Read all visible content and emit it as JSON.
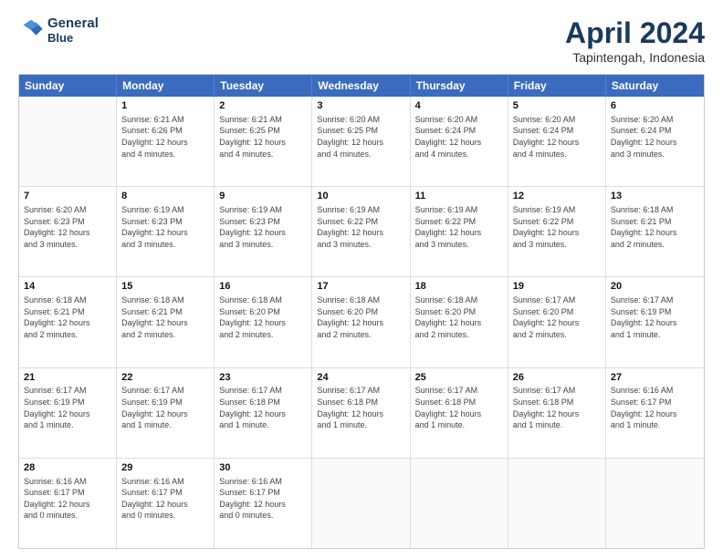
{
  "logo": {
    "line1": "General",
    "line2": "Blue"
  },
  "title": {
    "month_year": "April 2024",
    "location": "Tapintengah, Indonesia"
  },
  "header": {
    "days": [
      "Sunday",
      "Monday",
      "Tuesday",
      "Wednesday",
      "Thursday",
      "Friday",
      "Saturday"
    ]
  },
  "rows": [
    [
      {
        "day": "",
        "info": ""
      },
      {
        "day": "1",
        "info": "Sunrise: 6:21 AM\nSunset: 6:26 PM\nDaylight: 12 hours\nand 4 minutes."
      },
      {
        "day": "2",
        "info": "Sunrise: 6:21 AM\nSunset: 6:25 PM\nDaylight: 12 hours\nand 4 minutes."
      },
      {
        "day": "3",
        "info": "Sunrise: 6:20 AM\nSunset: 6:25 PM\nDaylight: 12 hours\nand 4 minutes."
      },
      {
        "day": "4",
        "info": "Sunrise: 6:20 AM\nSunset: 6:24 PM\nDaylight: 12 hours\nand 4 minutes."
      },
      {
        "day": "5",
        "info": "Sunrise: 6:20 AM\nSunset: 6:24 PM\nDaylight: 12 hours\nand 4 minutes."
      },
      {
        "day": "6",
        "info": "Sunrise: 6:20 AM\nSunset: 6:24 PM\nDaylight: 12 hours\nand 3 minutes."
      }
    ],
    [
      {
        "day": "7",
        "info": "Sunrise: 6:20 AM\nSunset: 6:23 PM\nDaylight: 12 hours\nand 3 minutes."
      },
      {
        "day": "8",
        "info": "Sunrise: 6:19 AM\nSunset: 6:23 PM\nDaylight: 12 hours\nand 3 minutes."
      },
      {
        "day": "9",
        "info": "Sunrise: 6:19 AM\nSunset: 6:23 PM\nDaylight: 12 hours\nand 3 minutes."
      },
      {
        "day": "10",
        "info": "Sunrise: 6:19 AM\nSunset: 6:22 PM\nDaylight: 12 hours\nand 3 minutes."
      },
      {
        "day": "11",
        "info": "Sunrise: 6:19 AM\nSunset: 6:22 PM\nDaylight: 12 hours\nand 3 minutes."
      },
      {
        "day": "12",
        "info": "Sunrise: 6:19 AM\nSunset: 6:22 PM\nDaylight: 12 hours\nand 3 minutes."
      },
      {
        "day": "13",
        "info": "Sunrise: 6:18 AM\nSunset: 6:21 PM\nDaylight: 12 hours\nand 2 minutes."
      }
    ],
    [
      {
        "day": "14",
        "info": "Sunrise: 6:18 AM\nSunset: 6:21 PM\nDaylight: 12 hours\nand 2 minutes."
      },
      {
        "day": "15",
        "info": "Sunrise: 6:18 AM\nSunset: 6:21 PM\nDaylight: 12 hours\nand 2 minutes."
      },
      {
        "day": "16",
        "info": "Sunrise: 6:18 AM\nSunset: 6:20 PM\nDaylight: 12 hours\nand 2 minutes."
      },
      {
        "day": "17",
        "info": "Sunrise: 6:18 AM\nSunset: 6:20 PM\nDaylight: 12 hours\nand 2 minutes."
      },
      {
        "day": "18",
        "info": "Sunrise: 6:18 AM\nSunset: 6:20 PM\nDaylight: 12 hours\nand 2 minutes."
      },
      {
        "day": "19",
        "info": "Sunrise: 6:17 AM\nSunset: 6:20 PM\nDaylight: 12 hours\nand 2 minutes."
      },
      {
        "day": "20",
        "info": "Sunrise: 6:17 AM\nSunset: 6:19 PM\nDaylight: 12 hours\nand 1 minute."
      }
    ],
    [
      {
        "day": "21",
        "info": "Sunrise: 6:17 AM\nSunset: 6:19 PM\nDaylight: 12 hours\nand 1 minute."
      },
      {
        "day": "22",
        "info": "Sunrise: 6:17 AM\nSunset: 6:19 PM\nDaylight: 12 hours\nand 1 minute."
      },
      {
        "day": "23",
        "info": "Sunrise: 6:17 AM\nSunset: 6:18 PM\nDaylight: 12 hours\nand 1 minute."
      },
      {
        "day": "24",
        "info": "Sunrise: 6:17 AM\nSunset: 6:18 PM\nDaylight: 12 hours\nand 1 minute."
      },
      {
        "day": "25",
        "info": "Sunrise: 6:17 AM\nSunset: 6:18 PM\nDaylight: 12 hours\nand 1 minute."
      },
      {
        "day": "26",
        "info": "Sunrise: 6:17 AM\nSunset: 6:18 PM\nDaylight: 12 hours\nand 1 minute."
      },
      {
        "day": "27",
        "info": "Sunrise: 6:16 AM\nSunset: 6:17 PM\nDaylight: 12 hours\nand 1 minute."
      }
    ],
    [
      {
        "day": "28",
        "info": "Sunrise: 6:16 AM\nSunset: 6:17 PM\nDaylight: 12 hours\nand 0 minutes."
      },
      {
        "day": "29",
        "info": "Sunrise: 6:16 AM\nSunset: 6:17 PM\nDaylight: 12 hours\nand 0 minutes."
      },
      {
        "day": "30",
        "info": "Sunrise: 6:16 AM\nSunset: 6:17 PM\nDaylight: 12 hours\nand 0 minutes."
      },
      {
        "day": "",
        "info": ""
      },
      {
        "day": "",
        "info": ""
      },
      {
        "day": "",
        "info": ""
      },
      {
        "day": "",
        "info": ""
      }
    ]
  ]
}
